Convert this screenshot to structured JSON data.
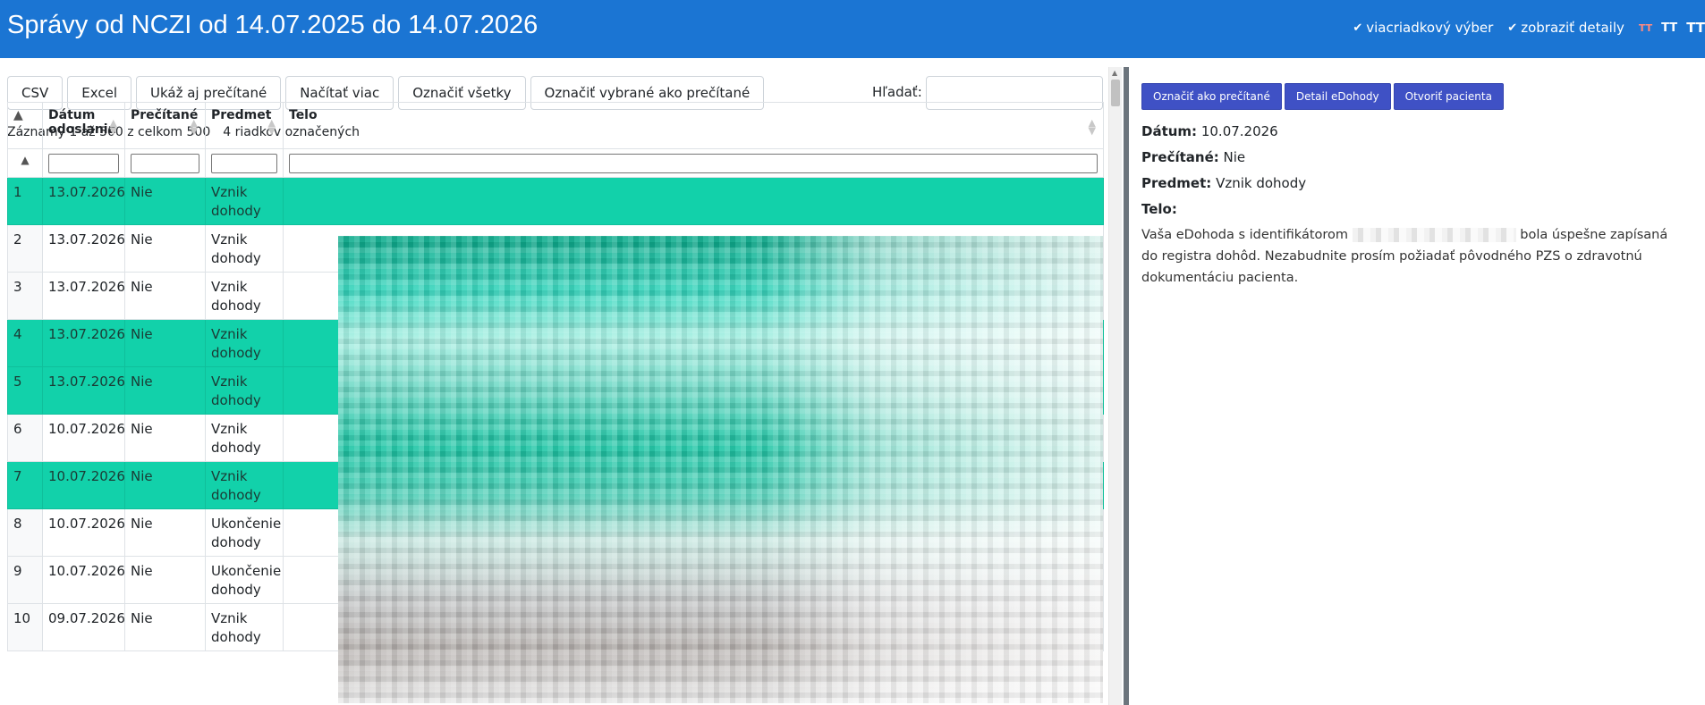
{
  "header": {
    "title": "Správy od NCZI od 14.07.2025 do 14.07.2026",
    "options": [
      {
        "check": "✔",
        "label": "viacriadkový výber"
      },
      {
        "check": "✔",
        "label": "zobraziť detaily"
      }
    ],
    "text_size_icons": [
      "TT",
      "TT",
      "TT"
    ]
  },
  "toolbar": {
    "buttons": [
      "CSV",
      "Excel",
      "Ukáž aj prečítané",
      "Načítať viac",
      "Označiť všetky",
      "Označiť vybrané ako prečítané"
    ],
    "search_label": "Hľadať:",
    "search_value": ""
  },
  "info": {
    "records": "Záznamy 1 až 500 z celkom 500",
    "selected": "4 riadkov označených"
  },
  "table": {
    "sort_glyph": "▲",
    "columns": [
      "Dátum odoslania",
      "Prečítané",
      "Predmet",
      "Telo"
    ],
    "rows": [
      {
        "num": "1",
        "date": "13.07.2026",
        "read": "Nie",
        "subject": "Vznik dohody",
        "selected": true
      },
      {
        "num": "2",
        "date": "13.07.2026",
        "read": "Nie",
        "subject": "Vznik dohody",
        "selected": false
      },
      {
        "num": "3",
        "date": "13.07.2026",
        "read": "Nie",
        "subject": "Vznik dohody",
        "selected": false
      },
      {
        "num": "4",
        "date": "13.07.2026",
        "read": "Nie",
        "subject": "Vznik dohody",
        "selected": true
      },
      {
        "num": "5",
        "date": "13.07.2026",
        "read": "Nie",
        "subject": "Vznik dohody",
        "selected": true
      },
      {
        "num": "6",
        "date": "10.07.2026",
        "read": "Nie",
        "subject": "Vznik dohody",
        "selected": false
      },
      {
        "num": "7",
        "date": "10.07.2026",
        "read": "Nie",
        "subject": "Vznik dohody",
        "selected": true
      },
      {
        "num": "8",
        "date": "10.07.2026",
        "read": "Nie",
        "subject": "Ukončenie dohody",
        "selected": false
      },
      {
        "num": "9",
        "date": "10.07.2026",
        "read": "Nie",
        "subject": "Ukončenie dohody",
        "selected": false
      },
      {
        "num": "10",
        "date": "09.07.2026",
        "read": "Nie",
        "subject": "Vznik dohody",
        "selected": false
      }
    ]
  },
  "detail_panel": {
    "buttons": [
      "Označiť ako prečítané",
      "Detail eDohody",
      "Otvoriť pacienta"
    ],
    "date_label": "Dátum:",
    "date_value": "10.07.2026",
    "read_label": "Prečítané:",
    "read_value": "Nie",
    "subject_label": "Predmet:",
    "subject_value": "Vznik dohody",
    "body_label": "Telo:",
    "body_before": "Vaša eDohoda s identifikátorom",
    "body_after": "bola úspešne zapísaná do registra dohôd. Nezabudnite prosím požiadať pôvodného PZS o zdravotnú dokumentáciu pacienta."
  },
  "colors": {
    "header_bg": "#1b75d3",
    "selected_row": "#12d1aa",
    "action_button": "#3f51c5"
  }
}
